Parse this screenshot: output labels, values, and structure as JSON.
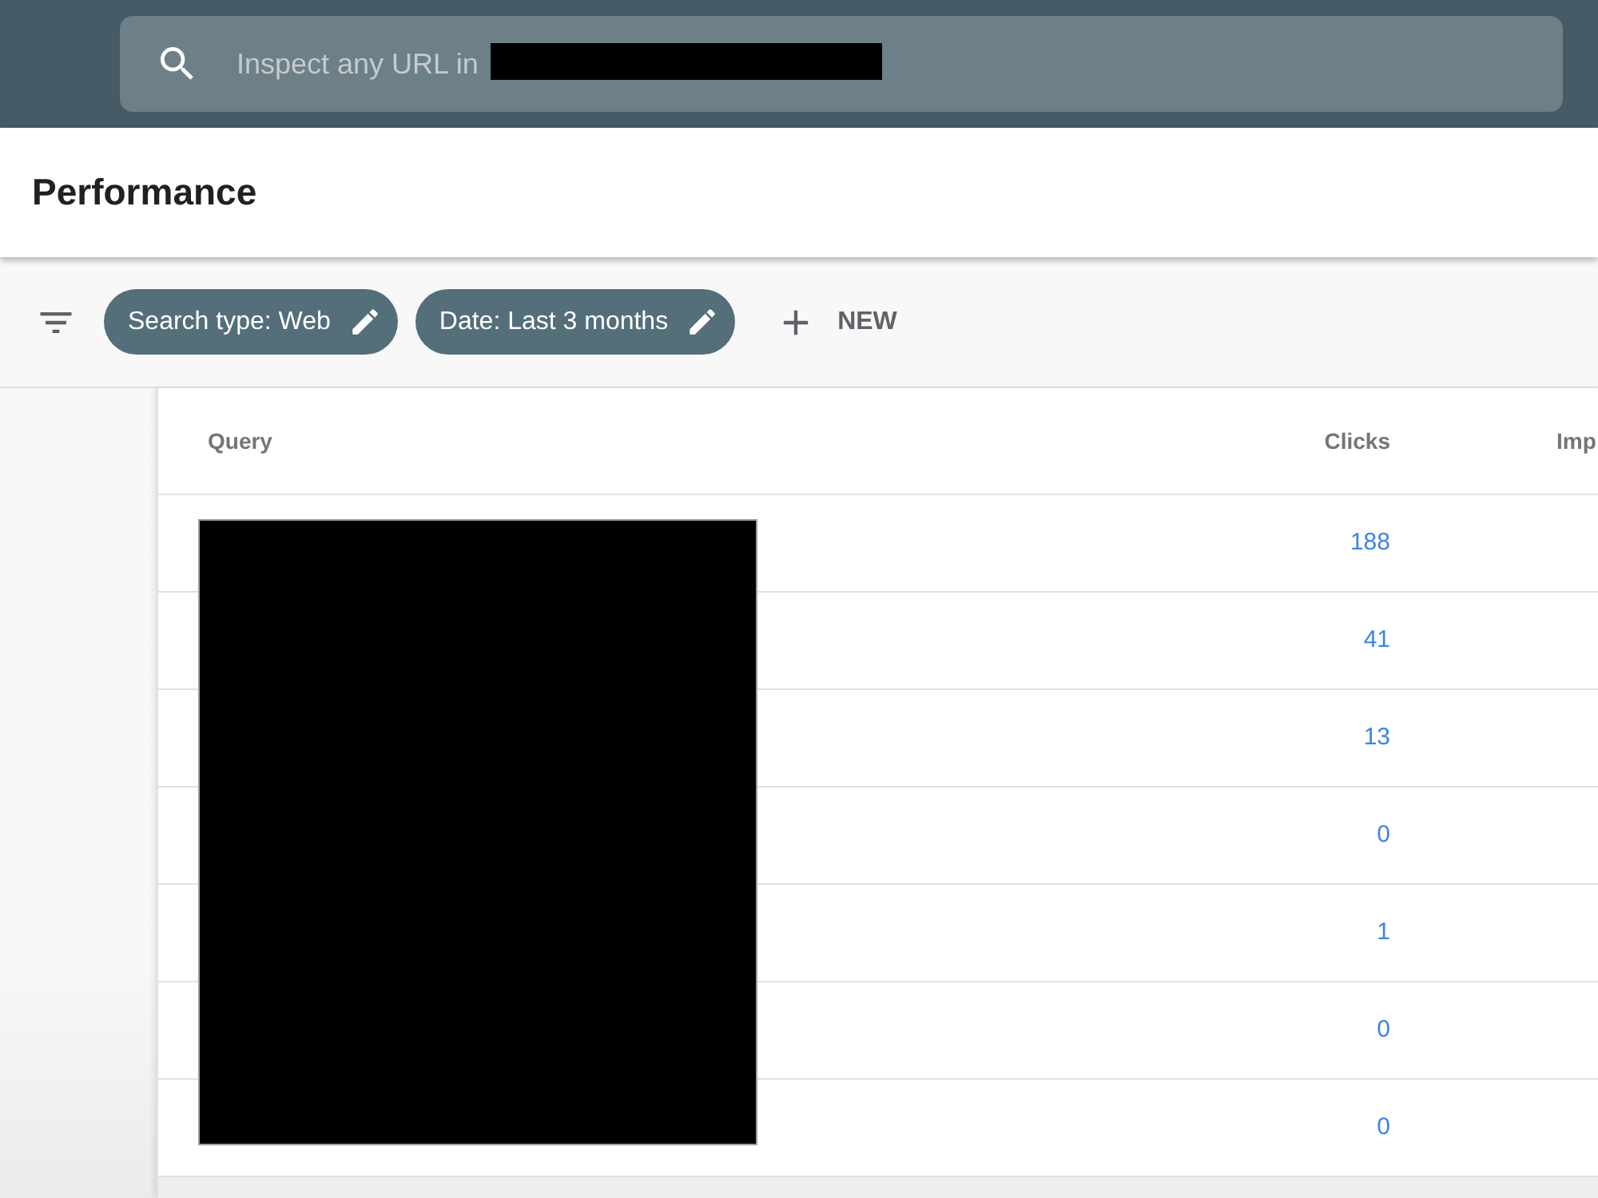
{
  "search": {
    "placeholder": "Inspect any URL in"
  },
  "page_title": "Performance",
  "filters": {
    "chips": [
      {
        "label": "Search type: Web"
      },
      {
        "label": "Date: Last 3 months"
      }
    ],
    "new_button": "NEW"
  },
  "table": {
    "columns": [
      "Query",
      "Clicks",
      "Imp"
    ],
    "rows": [
      {
        "clicks": "188"
      },
      {
        "clicks": "41"
      },
      {
        "clicks": "13"
      },
      {
        "clicks": "0"
      },
      {
        "clicks": "1"
      },
      {
        "clicks": "0"
      },
      {
        "clicks": "0"
      }
    ]
  }
}
